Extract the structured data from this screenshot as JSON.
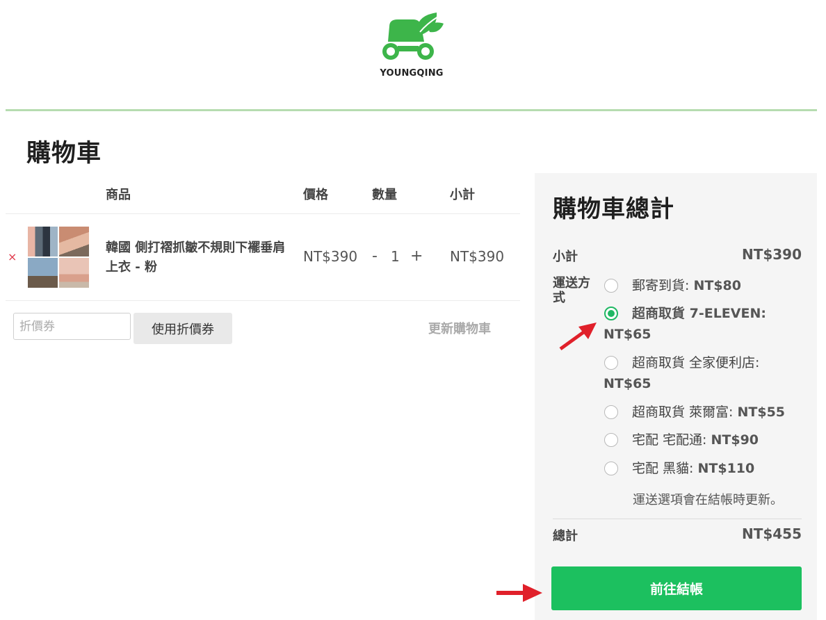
{
  "brand": {
    "name": "YOUNGQING",
    "color": "#3db54a"
  },
  "page": {
    "title": "購物車"
  },
  "cart": {
    "headers": {
      "product": "商品",
      "price": "價格",
      "quantity": "數量",
      "subtotal": "小計"
    },
    "items": [
      {
        "remove_icon": "×",
        "name": "韓國 側打褶抓皺不規則下襬垂肩上衣 - 粉",
        "price": "NT$390",
        "quantity": "1",
        "minus": "-",
        "plus": "+",
        "subtotal": "NT$390"
      }
    ],
    "coupon": {
      "placeholder": "折價券",
      "apply_label": "使用折價券"
    },
    "update_label": "更新購物車"
  },
  "totals": {
    "title": "購物車總計",
    "subtotal_label": "小計",
    "subtotal_value": "NT$390",
    "shipping_label": "運送方式",
    "shipping_options": [
      {
        "label": "郵寄到貨:",
        "price": "NT$80",
        "selected": false
      },
      {
        "label": "超商取貨 7-ELEVEN:",
        "price": "NT$65",
        "selected": true
      },
      {
        "label": "超商取貨 全家便利店:",
        "price": "NT$65",
        "selected": false
      },
      {
        "label": "超商取貨 萊爾富:",
        "price": "NT$55",
        "selected": false
      },
      {
        "label": "宅配 宅配通:",
        "price": "NT$90",
        "selected": false
      },
      {
        "label": "宅配 黑貓:",
        "price": "NT$110",
        "selected": false
      }
    ],
    "shipping_note": "運送選項會在結帳時更新。",
    "total_label": "總計",
    "total_value": "NT$455",
    "checkout_label": "前往結帳"
  },
  "colors": {
    "accent": "#1cc05f",
    "remove": "#e0394b",
    "arrow": "#e0202a",
    "divider": "#b6dcb0"
  }
}
